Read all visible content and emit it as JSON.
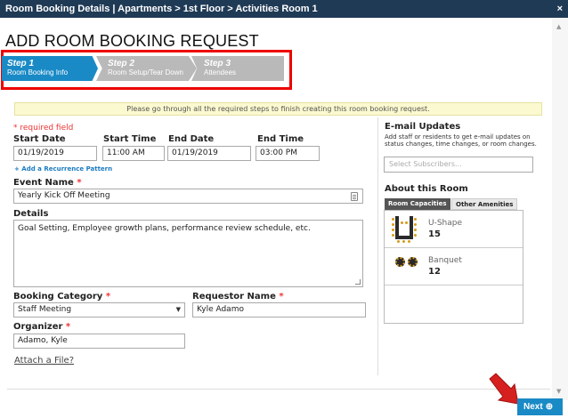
{
  "window": {
    "title": "Room Booking Details | Apartments > 1st Floor > Activities Room 1",
    "close": "×"
  },
  "page_title": "ADD ROOM BOOKING REQUEST",
  "steps": [
    {
      "num": "Step 1",
      "label": "Room Booking Info"
    },
    {
      "num": "Step 2",
      "label": "Room Setup/Tear Down"
    },
    {
      "num": "Step 3",
      "label": "Attendees"
    }
  ],
  "notice": "Please go through all the required steps to finish creating this room booking request.",
  "form": {
    "required_note": "* required field",
    "start_date_label": "Start Date",
    "start_date": "01/19/2019",
    "start_time_label": "Start Time",
    "start_time": "11:00 AM",
    "end_date_label": "End Date",
    "end_date": "01/19/2019",
    "end_time_label": "End Time",
    "end_time": "03:00 PM",
    "recurrence_link": "+ Add a Recurrence Pattern",
    "event_name_label": "Event Name",
    "event_name": "Yearly Kick Off Meeting",
    "details_label": "Details",
    "details": "Goal Setting, Employee growth plans, performance review schedule, etc.",
    "booking_category_label": "Booking Category",
    "booking_category": "Staff Meeting",
    "requestor_label": "Requestor Name",
    "requestor": "Kyle Adamo",
    "organizer_label": "Organizer",
    "organizer": "Adamo, Kyle",
    "attach_link": "Attach a File?"
  },
  "email": {
    "title": "E-mail Updates",
    "desc": "Add staff or residents to get e-mail updates on status changes, time changes, or room changes.",
    "placeholder": "Select Subscribers..."
  },
  "about": {
    "title": "About this Room",
    "tabs": [
      "Room Capacities",
      "Other Amenities"
    ],
    "capacities": [
      {
        "name": "U-Shape",
        "value": "15"
      },
      {
        "name": "Banquet",
        "value": "12"
      }
    ]
  },
  "next_label": "Next"
}
